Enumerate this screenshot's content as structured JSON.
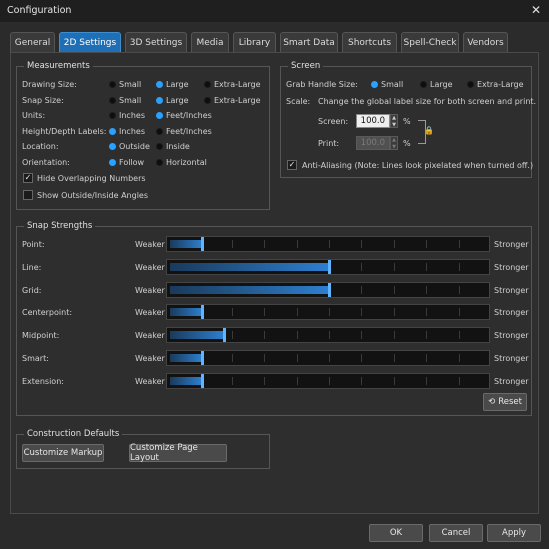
{
  "window": {
    "title": "Configuration",
    "close_glyph": "✕"
  },
  "tabs": [
    {
      "label": "General",
      "active": false
    },
    {
      "label": "2D Settings",
      "active": true
    },
    {
      "label": "3D Settings",
      "active": false
    },
    {
      "label": "Media",
      "active": false
    },
    {
      "label": "Library",
      "active": false
    },
    {
      "label": "Smart Data",
      "active": false
    },
    {
      "label": "Shortcuts",
      "active": false
    },
    {
      "label": "Spell-Check",
      "active": false
    },
    {
      "label": "Vendors",
      "active": false
    }
  ],
  "measurements": {
    "title": "Measurements",
    "rows": [
      {
        "label": "Drawing Size:",
        "options": [
          "Small",
          "Large",
          "Extra-Large"
        ],
        "selected": 1
      },
      {
        "label": "Snap Size:",
        "options": [
          "Small",
          "Large",
          "Extra-Large"
        ],
        "selected": 1
      },
      {
        "label": "Units:",
        "options": [
          "Inches",
          "Feet/Inches"
        ],
        "selected": 1
      },
      {
        "label": "Height/Depth Labels:",
        "options": [
          "Inches",
          "Feet/Inches"
        ],
        "selected": 0
      },
      {
        "label": "Location:",
        "options": [
          "Outside",
          "Inside"
        ],
        "selected": 0
      },
      {
        "label": "Orientation:",
        "options": [
          "Follow",
          "Horizontal"
        ],
        "selected": 0
      }
    ],
    "hide_overlapping": {
      "label": "Hide Overlapping Numbers",
      "checked": true
    },
    "show_angles": {
      "label": "Show Outside/Inside Angles",
      "checked": false
    }
  },
  "screen": {
    "title": "Screen",
    "grab_label": "Grab Handle Size:",
    "grab_options": [
      "Small",
      "Large",
      "Extra-Large"
    ],
    "grab_selected": 0,
    "scale_label": "Scale:",
    "scale_desc": "Change the global label size for both screen and print.",
    "screen_label": "Screen:",
    "screen_value": "100.0",
    "print_label": "Print:",
    "print_value": "100.0",
    "percent": "%",
    "lock_glyph": "🔒",
    "anti_aliasing": {
      "label": "Anti-Aliasing (Note: Lines look pixelated when turned off.)",
      "checked": true
    }
  },
  "snap": {
    "title": "Snap Strengths",
    "weaker": "Weaker",
    "stronger": "Stronger",
    "rows": [
      {
        "label": "Point:",
        "value": 0.1
      },
      {
        "label": "Line:",
        "value": 0.5
      },
      {
        "label": "Grid:",
        "value": 0.5
      },
      {
        "label": "Centerpoint:",
        "value": 0.1
      },
      {
        "label": "Midpoint:",
        "value": 0.17
      },
      {
        "label": "Smart:",
        "value": 0.1
      },
      {
        "label": "Extension:",
        "value": 0.1
      }
    ],
    "reset_label": "Reset",
    "reset_glyph": "⟲"
  },
  "construction": {
    "title": "Construction Defaults",
    "markup_label": "Customize Markup",
    "page_layout_label": "Customize Page Layout"
  },
  "footer": {
    "ok": "OK",
    "cancel": "Cancel",
    "apply": "Apply"
  },
  "colors": {
    "accent": "#2aa0ff",
    "active_tab": "#1e6fb5",
    "background": "#2b2b2b"
  }
}
